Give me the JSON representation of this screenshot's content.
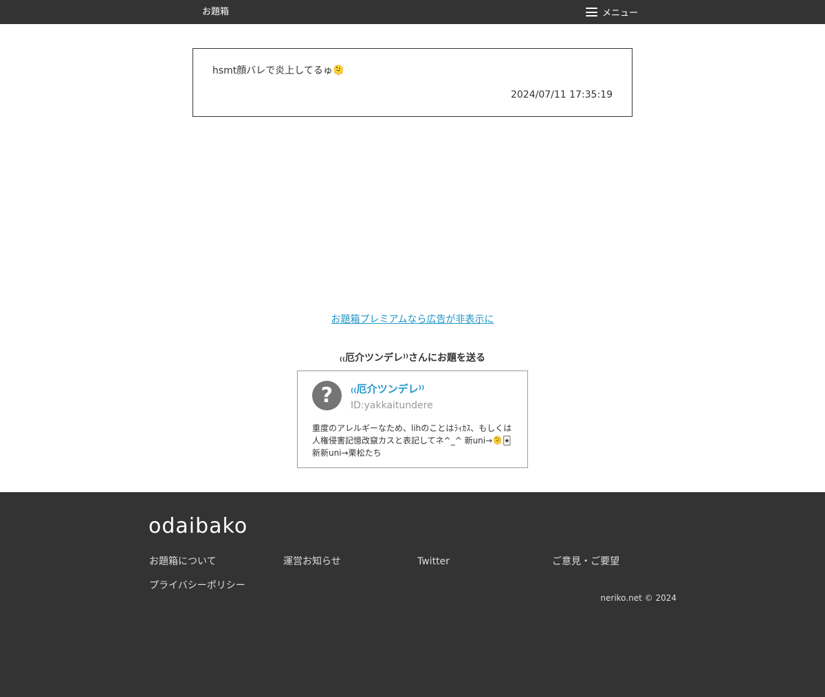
{
  "header": {
    "brand": "お題箱",
    "menu_label": "メニュー",
    "menu_icon": "hamburger-icon"
  },
  "question": {
    "text": "hsmt顔バレで炎上してるゅ🫠",
    "date": "2024/07/11 17:35:19"
  },
  "premium_link": "お題箱プレミアムなら広告が非表示に",
  "send": {
    "title": "₍₍厄介ツンデレ⁾⁾さんにお題を送る"
  },
  "profile": {
    "avatar_glyph": "?",
    "name": "₍₍厄介ツンデレ⁾⁾",
    "id": "ID:yakkaitundere",
    "bio": "重度のアレルギーなため、lihのことはﾗｨｶｽ、もしくは人権侵害記憶改竄カスと表記してネ^_^ 新uni→🫠🃏 新新uni→栗松たち"
  },
  "footer": {
    "logo": "odaibako",
    "links": {
      "about": "お題箱について",
      "news": "運営お知らせ",
      "twitter": "Twitter",
      "feedback": "ご意見・ご要望",
      "privacy": "プライバシーポリシー"
    },
    "copyright": "neriko.net © 2024"
  },
  "colors": {
    "header_bg": "#333333",
    "footer_bg": "#333333",
    "accent": "#2196c9",
    "avatar_bg": "#757575"
  }
}
